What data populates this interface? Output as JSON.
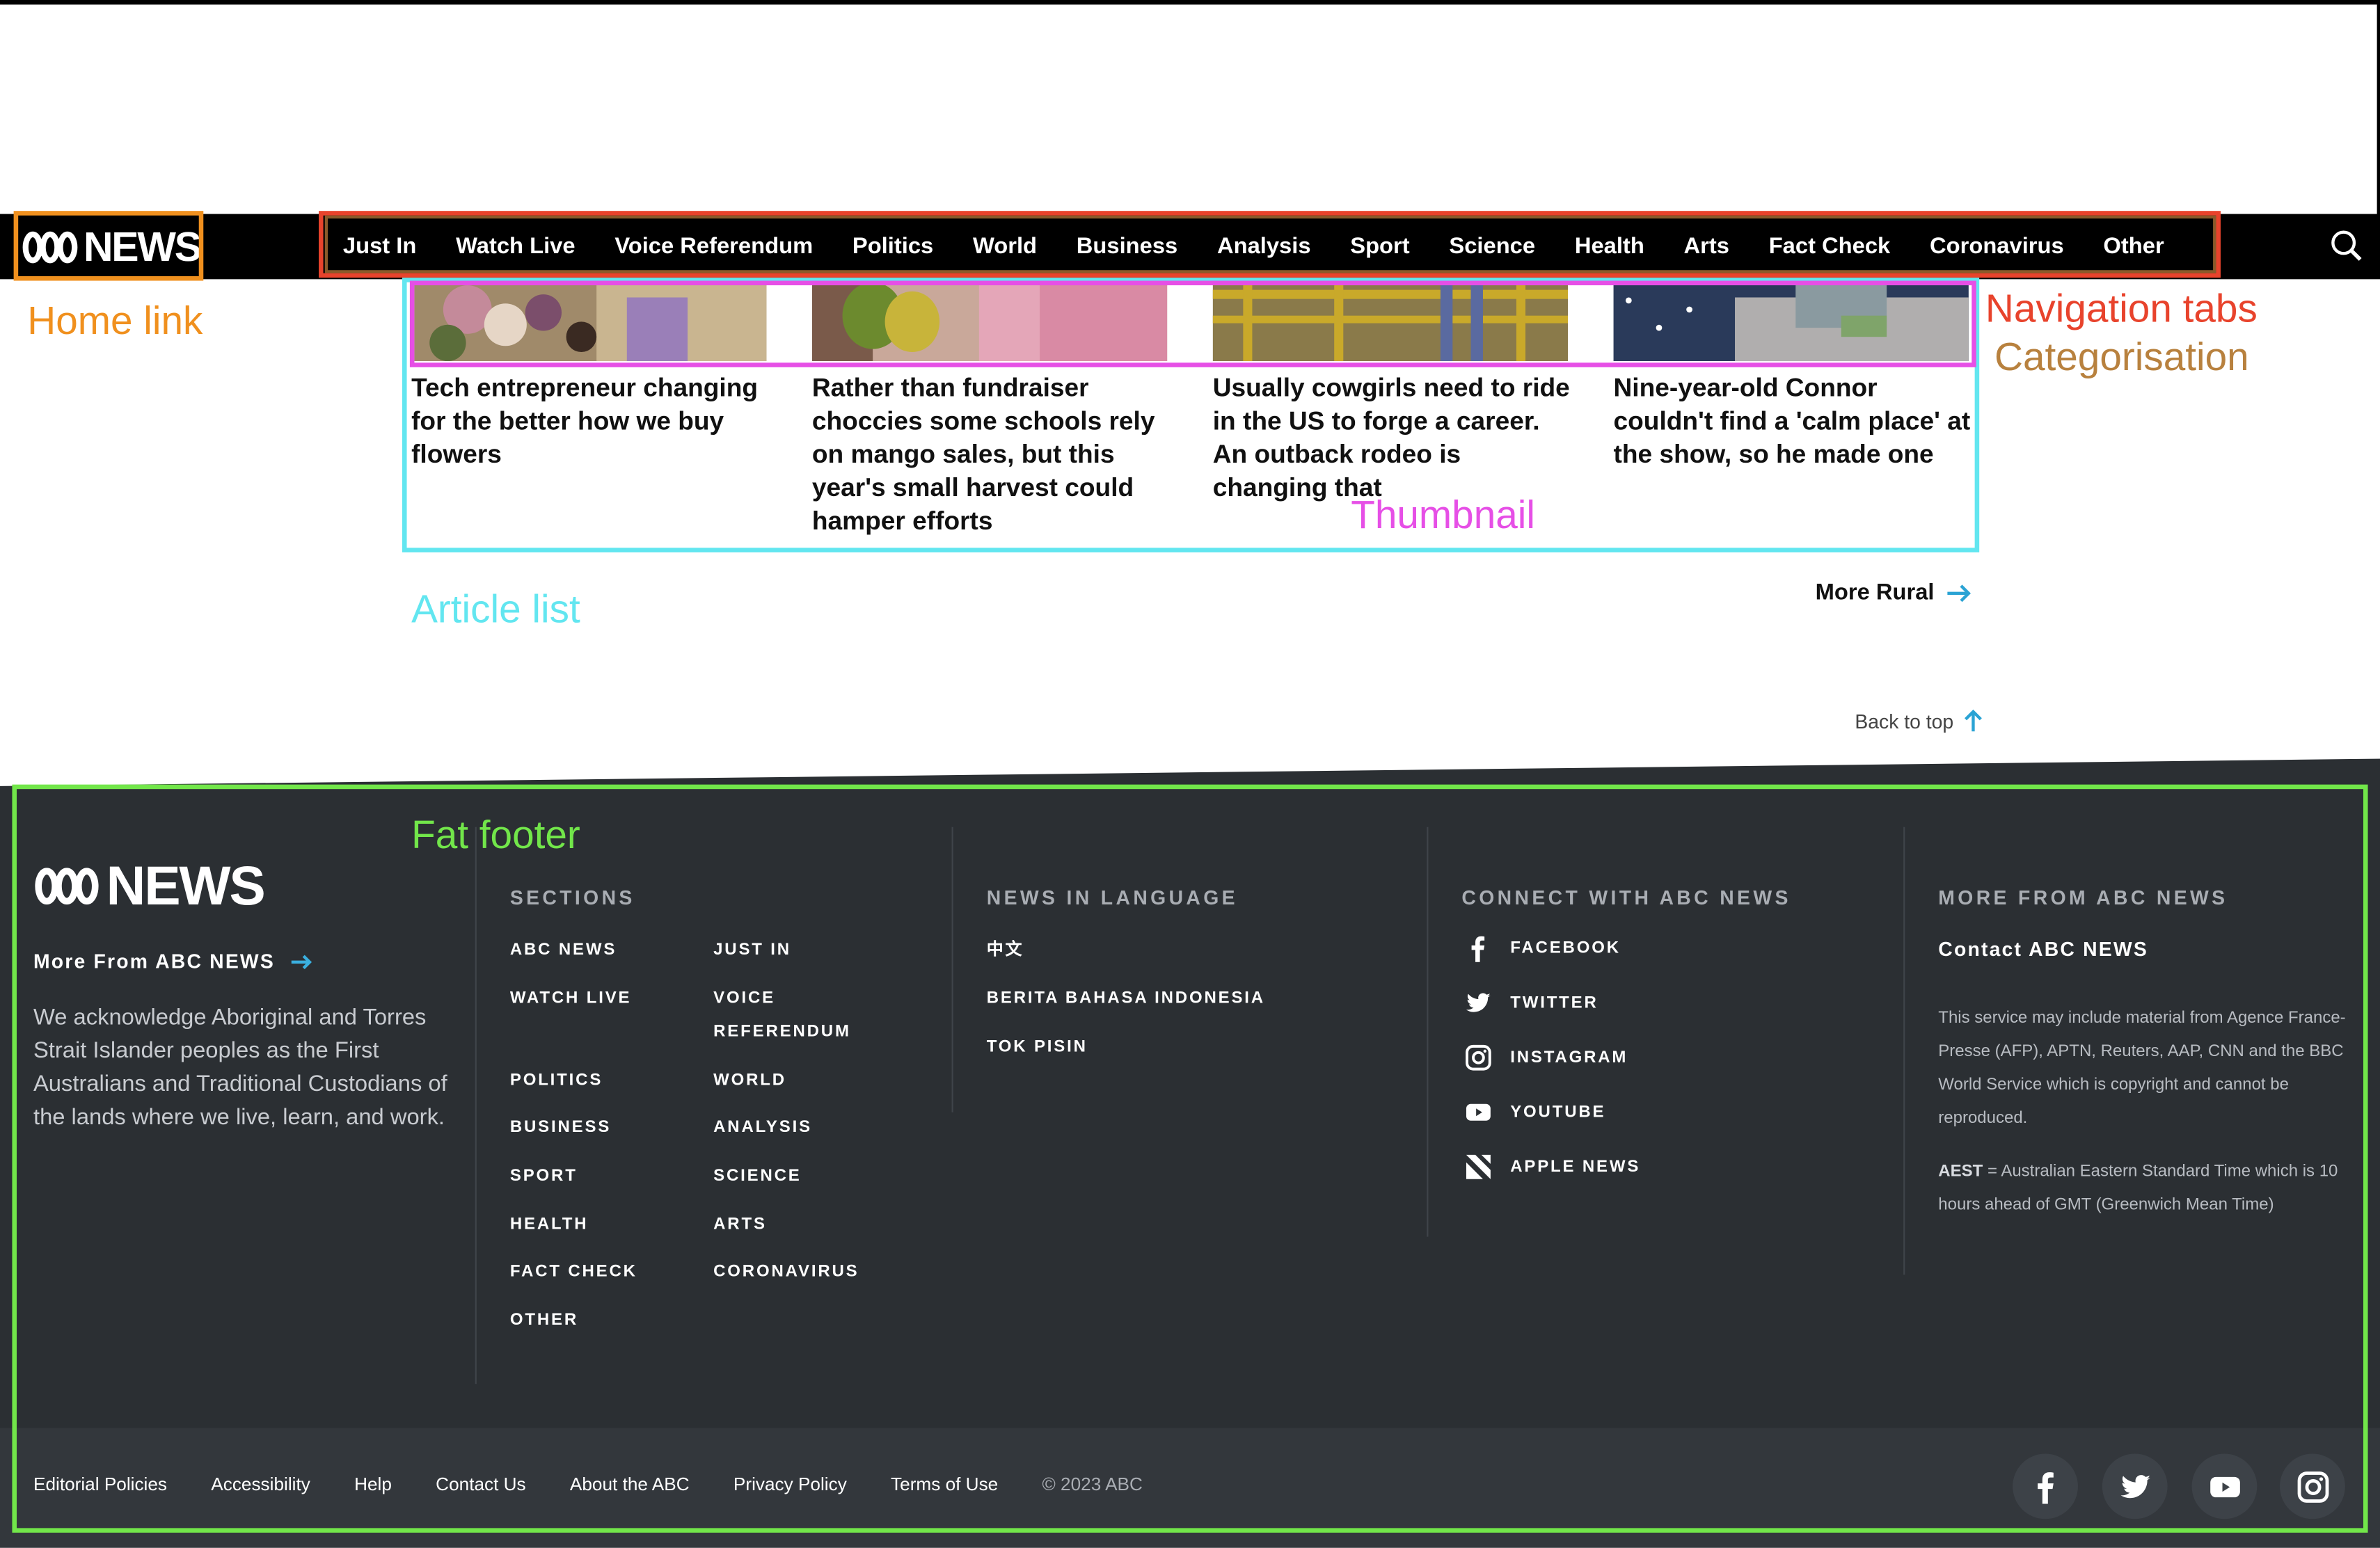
{
  "header": {
    "logo_text": "NEWS",
    "nav_tabs": [
      "Just In",
      "Watch Live",
      "Voice Referendum",
      "Politics",
      "World",
      "Business",
      "Analysis",
      "Sport",
      "Science",
      "Health",
      "Arts",
      "Fact Check",
      "Coronavirus",
      "Other"
    ]
  },
  "annotations": {
    "home_link": "Home link",
    "navigation_tabs": "Navigation tabs",
    "categorisation": "Categorisation",
    "thumbnail": "Thumbnail",
    "article_list": "Article list",
    "fat_footer": "Fat footer"
  },
  "annotation_colors": {
    "home_link": "#f0901e",
    "navigation_tabs": "#e8432c",
    "categorisation": "#b8813e",
    "thumbnail": "#e64fe6",
    "article_list": "#62e6f0",
    "fat_footer": "#72e64a"
  },
  "articles": [
    {
      "title": "Tech entrepreneur changing for the better how we buy flowers",
      "image": "flowers-photo"
    },
    {
      "title": "Rather than fundraiser choccies some schools rely on mango sales, but this year's small harvest could hamper efforts",
      "image": "mangoes-photo"
    },
    {
      "title": "Usually cowgirls need to ride in the US to forge a career. An outback rodeo is changing that",
      "image": "rodeo-photo"
    },
    {
      "title": "Nine-year-old Connor couldn't find a 'calm place' at the show, so he made one",
      "image": "boy-reading-photo"
    }
  ],
  "more_rural": "More Rural",
  "back_to_top": "Back to top",
  "footer": {
    "logo_text": "NEWS",
    "more_from": "More From ABC NEWS",
    "acknowledgement": "We acknowledge Aboriginal and Torres Strait Islander peoples as the First Australians and Traditional Custodians of the lands where we live, learn, and work.",
    "sections_heading": "SECTIONS",
    "sections_col1": [
      "ABC NEWS",
      "WATCH LIVE",
      "POLITICS",
      "BUSINESS",
      "SPORT",
      "HEALTH",
      "FACT CHECK",
      "OTHER"
    ],
    "sections_col2": [
      "JUST IN",
      "VOICE REFERENDUM",
      "WORLD",
      "ANALYSIS",
      "SCIENCE",
      "ARTS",
      "CORONAVIRUS"
    ],
    "language_heading": "NEWS IN LANGUAGE",
    "languages": [
      "中文",
      "BERITA BAHASA INDONESIA",
      "TOK PISIN"
    ],
    "connect_heading": "CONNECT WITH ABC NEWS",
    "social": [
      {
        "label": "FACEBOOK",
        "icon": "facebook-icon"
      },
      {
        "label": "TWITTER",
        "icon": "twitter-icon"
      },
      {
        "label": "INSTAGRAM",
        "icon": "instagram-icon"
      },
      {
        "label": "YOUTUBE",
        "icon": "youtube-icon"
      },
      {
        "label": "APPLE NEWS",
        "icon": "apple-news-icon"
      }
    ],
    "more_heading": "MORE FROM ABC NEWS",
    "contact": "Contact ABC NEWS",
    "disclaimer": "This service may include material from Agence France-Presse (AFP), APTN, Reuters, AAP, CNN and the BBC World Service which is copyright and cannot be reproduced.",
    "aest_abbr": "AEST",
    "aest_text": " = Australian Eastern Standard Time which is 10 hours ahead of GMT (Greenwich Mean Time)",
    "bottom_links": [
      "Editorial Policies",
      "Accessibility",
      "Help",
      "Contact Us",
      "About the ABC",
      "Privacy Policy",
      "Terms of Use"
    ],
    "copyright": "© 2023 ABC"
  }
}
